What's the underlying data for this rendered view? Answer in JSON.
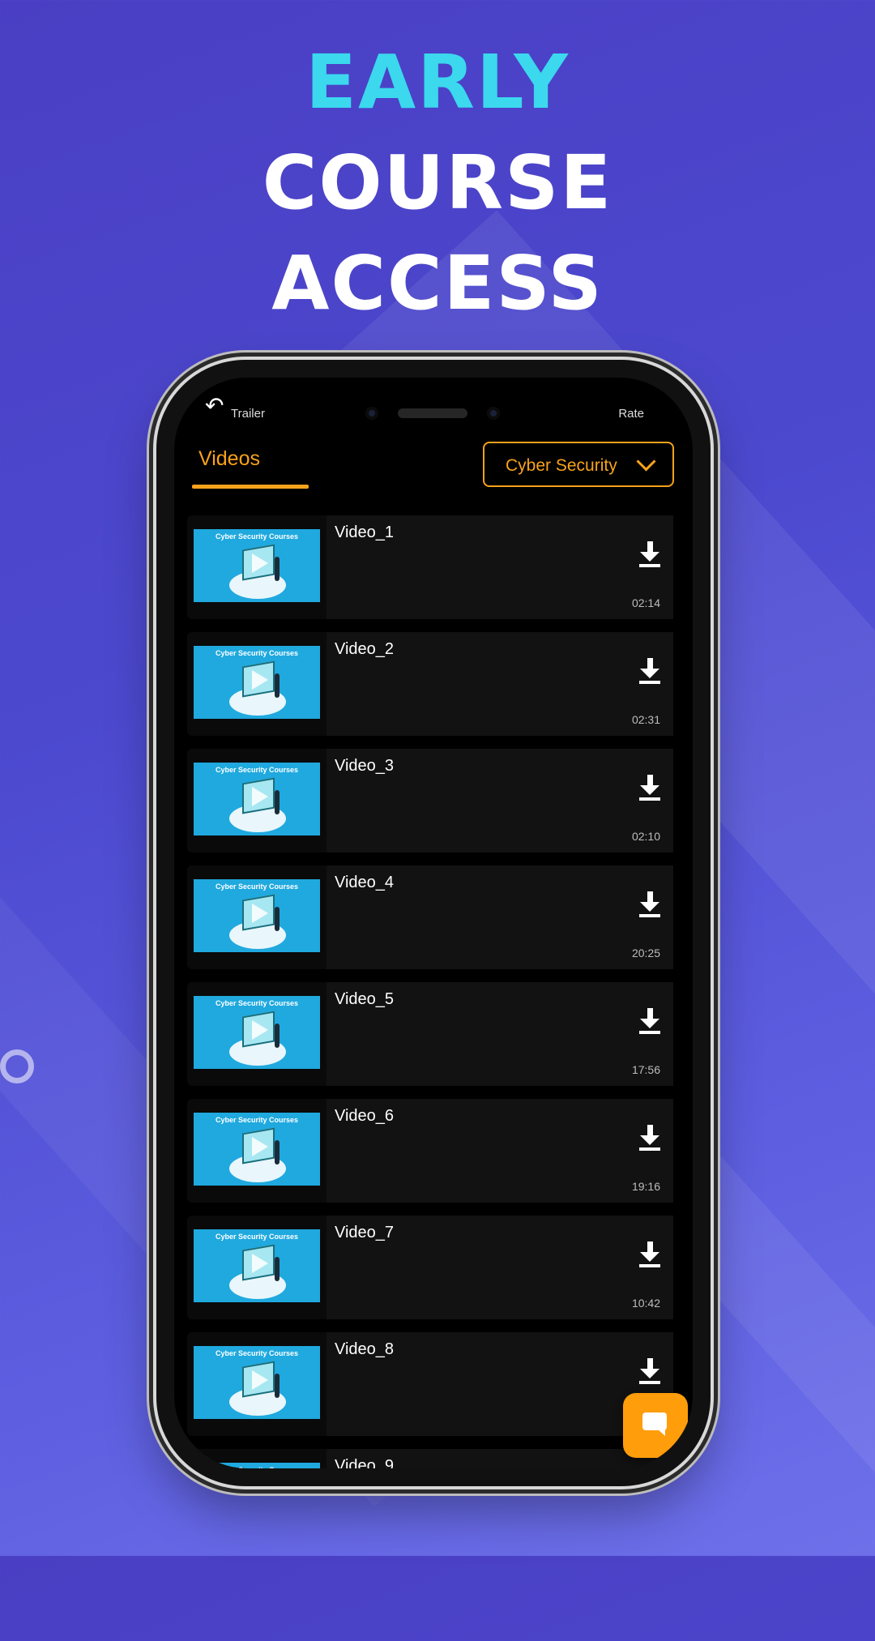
{
  "headline": {
    "line1": "EARLY",
    "line2": "COURSE",
    "line3": "ACCESS"
  },
  "colors": {
    "accent": "#3bd8ee",
    "orange": "#f7a21b",
    "background": "#4c49cf"
  },
  "topbar": {
    "back_icon": "back-arrow-icon",
    "trailer_label": "Trailer",
    "rate_label": "Rate"
  },
  "tabs": {
    "videos_label": "Videos"
  },
  "category": {
    "selected": "Cyber Security"
  },
  "thumbnail_caption": "Cyber Security Courses",
  "videos": [
    {
      "title": "Video_1",
      "duration": "02:14"
    },
    {
      "title": "Video_2",
      "duration": "02:31"
    },
    {
      "title": "Video_3",
      "duration": "02:10"
    },
    {
      "title": "Video_4",
      "duration": "20:25"
    },
    {
      "title": "Video_5",
      "duration": "17:56"
    },
    {
      "title": "Video_6",
      "duration": "19:16"
    },
    {
      "title": "Video_7",
      "duration": "10:42"
    },
    {
      "title": "Video_8",
      "duration": ""
    },
    {
      "title": "Video_9",
      "duration": ""
    }
  ],
  "fab": {
    "icon": "chat-icon"
  }
}
